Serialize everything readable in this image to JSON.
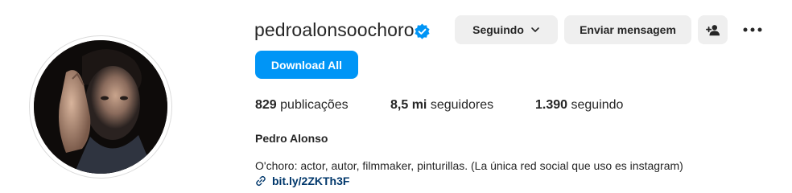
{
  "profile": {
    "username": "pedroalonsoochoro",
    "full_name": "Pedro Alonso",
    "bio": "O'choro: actor, autor, filmmaker, pinturillas. (La única red social que uso es instagram)",
    "link": "bit.ly/2ZKTh3F",
    "verified": true
  },
  "actions": {
    "following_label": "Seguindo",
    "message_label": "Enviar mensagem",
    "download_label": "Download All"
  },
  "stats": {
    "posts_count": "829",
    "posts_label": "publicações",
    "followers_count": "8,5 mi",
    "followers_label": "seguidores",
    "following_count": "1.390",
    "following_label": "seguindo"
  },
  "colors": {
    "primary_blue": "#0095f6",
    "verified_blue": "#0095f6",
    "button_gray": "#efefef",
    "link_color": "#00376b"
  },
  "icons": [
    "verified-badge-icon",
    "chevron-down-icon",
    "add-user-icon",
    "more-options-icon",
    "link-icon"
  ]
}
